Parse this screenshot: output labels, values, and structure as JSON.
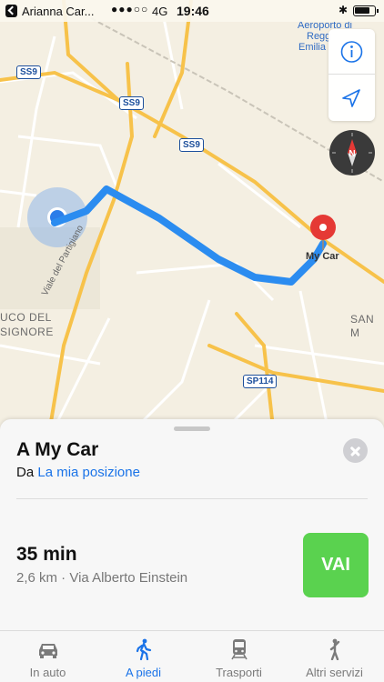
{
  "status_bar": {
    "back_app": "Arianna Car...",
    "signal": "●●●○○",
    "network": "4G",
    "time": "19:46",
    "bluetooth": "✱"
  },
  "map": {
    "road_labels": [
      "SS9",
      "SS9",
      "SS9",
      "SP114"
    ],
    "place_labels": [
      "Aeroporto di",
      "Regg",
      "Emilia"
    ],
    "area_labels": [
      "UCO DEL",
      "SIGNORE",
      "SAN M"
    ],
    "street_label": "Viale del Partigiano",
    "destination_label": "My Car",
    "colors": {
      "route": "#2b8cf0",
      "pin": "#e53935",
      "road_major": "#f7c24a"
    }
  },
  "sheet": {
    "destination_title": "A My Car",
    "from_prefix": "Da",
    "from_link": "La mia posizione",
    "duration": "35 min",
    "route_info": "2,6 km · Via Alberto Einstein",
    "go_label": "VAI",
    "colors": {
      "go": "#5ad24f",
      "link": "#1a73e8"
    }
  },
  "tabs": [
    {
      "label": "In auto",
      "icon": "car-icon",
      "active": false
    },
    {
      "label": "A piedi",
      "icon": "walk-icon",
      "active": true
    },
    {
      "label": "Trasporti",
      "icon": "train-icon",
      "active": false
    },
    {
      "label": "Altri servizi",
      "icon": "person-icon",
      "active": false
    }
  ]
}
